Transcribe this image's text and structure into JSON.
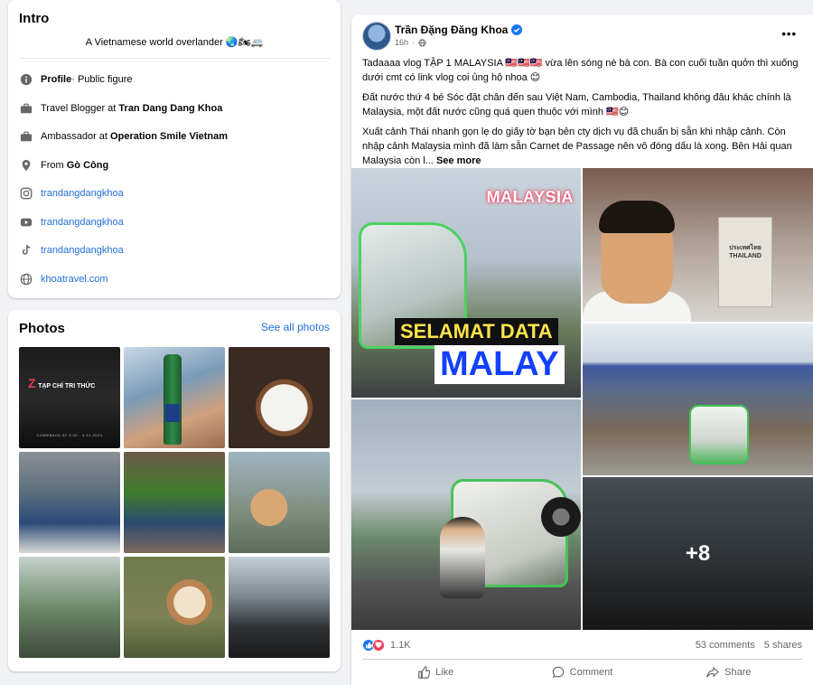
{
  "intro": {
    "title": "Intro",
    "bio": "A Vietnamese world overlander 🌏🏍🚐",
    "rows": [
      {
        "icon": "info-icon",
        "bold": "Profile",
        "text": " · Public figure"
      },
      {
        "icon": "briefcase-icon",
        "text": "Travel Blogger at ",
        "bold": "Tran Dang Dang Khoa"
      },
      {
        "icon": "briefcase-icon",
        "text": "Ambassador at ",
        "bold": "Operation Smile Vietnam"
      },
      {
        "icon": "location-icon",
        "text": "From ",
        "bold": "Gò Công"
      },
      {
        "icon": "instagram-icon",
        "link": "trandangdangkhoa"
      },
      {
        "icon": "youtube-icon",
        "link": "trandangdangkhoa"
      },
      {
        "icon": "tiktok-icon",
        "link": "trandangdangkhoa"
      },
      {
        "icon": "globe-icon",
        "link": "khoatravel.com"
      }
    ]
  },
  "photos": {
    "title": "Photos",
    "see_all": "See all photos",
    "photo1_brand": "TẠP CHÍ TRI THỨC",
    "photo1_tagline": "COMEBACK AT 0:00 - 4.12.2023"
  },
  "post": {
    "author": "Trần Đặng Đăng Khoa",
    "time": "16h",
    "more_label": "•••",
    "paragraphs": [
      "Tadaaaa vlog TẬP 1 MALAYSIA 🇲🇾🇲🇾🇲🇾 vừa lên sóng nè bà con. Bà con cuối tuần quởn thì xuống dưới cmt có link vlog coi ủng hộ nhoa 😊",
      "Đất nước thứ 4 bé Sóc đặt chân đến sau Việt Nam, Cambodia, Thailand không đâu khác chính là Malaysia, một đất nước cũng quá quen thuộc với mình 🇲🇾😊",
      "Xuất cảnh Thái nhanh gọn lẹ do giấy tờ bạn bên cty dịch vụ đã chuẩn bị sẵn khi nhập cảnh. Còn nhập cảnh Malaysia mình đã làm sẵn Carnet de Passage nên vô đóng dấu là xong. Bên Hải quan Malaysia còn l..."
    ],
    "see_more": "See more",
    "media": {
      "a_tag1": "MALAYSIA",
      "a_tag2": "SELAMAT DATA",
      "a_tag3": "MALAY",
      "b_marker": "ประเทศไทย THAILAND",
      "e_overlay": "+8"
    },
    "reactions_count": "1.1K",
    "comments": "53 comments",
    "shares": "5 shares",
    "actions": {
      "like": "Like",
      "comment": "Comment",
      "share": "Share"
    }
  }
}
